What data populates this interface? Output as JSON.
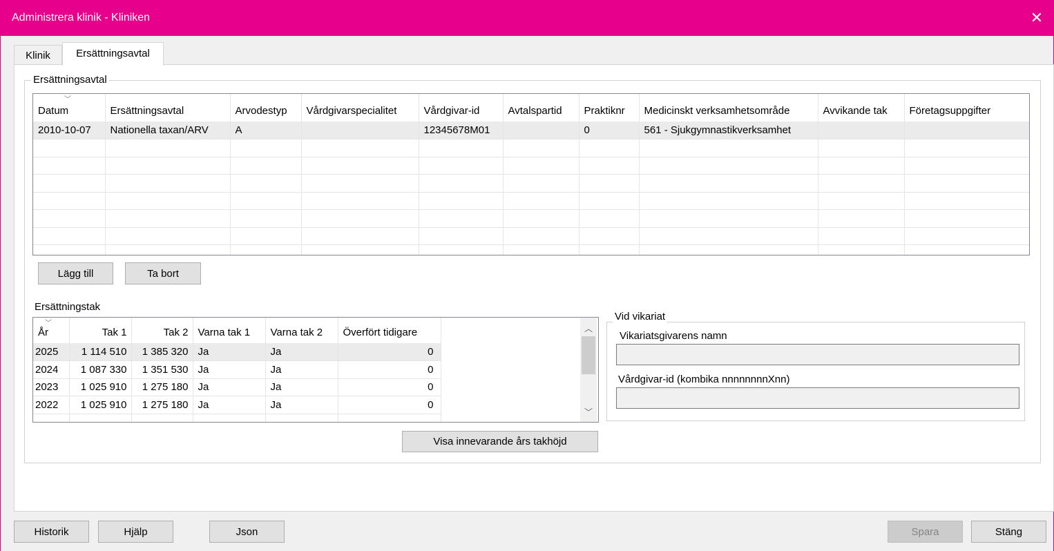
{
  "window": {
    "title": "Administrera klinik - Kliniken",
    "close_glyph": "✕",
    "accent_color": "#e6008b"
  },
  "tabs": [
    {
      "label": "Klinik",
      "active": false
    },
    {
      "label": "Ersättningsavtal",
      "active": true
    }
  ],
  "agreements": {
    "group_label": "Ersättningsavtal",
    "columns": [
      "Datum",
      "Ersättningsavtal",
      "Arvodestyp",
      "Vårdgivarspecialitet",
      "Vårdgivar-id",
      "Avtalspartid",
      "Praktiknr",
      "Medicinskt verksamhetsområde",
      "Avvikande tak",
      "Företagsuppgifter"
    ],
    "rows": [
      [
        "2010-10-07",
        "Nationella taxan/ARV",
        "A",
        "",
        "12345678M01",
        "",
        "0",
        "561 - Sjukgymnastikverksamhet",
        "",
        ""
      ]
    ],
    "add_button": "Lägg till",
    "remove_button": "Ta bort"
  },
  "caps": {
    "label": "Ersättningstak",
    "columns": [
      "År",
      "Tak 1",
      "Tak 2",
      "Varna tak 1",
      "Varna tak 2",
      "Överfört tidigare"
    ],
    "rows": [
      [
        "2025",
        "1 114 510",
        "1 385 320",
        "Ja",
        "Ja",
        "0"
      ],
      [
        "2024",
        "1 087 330",
        "1 351 530",
        "Ja",
        "Ja",
        "0"
      ],
      [
        "2023",
        "1 025 910",
        "1 275 180",
        "Ja",
        "Ja",
        "0"
      ],
      [
        "2022",
        "1 025 910",
        "1 275 180",
        "Ja",
        "Ja",
        "0"
      ]
    ],
    "show_current_button": "Visa innevarande års takhöjd"
  },
  "substitute": {
    "group_label": "Vid vikariat",
    "name_label": "Vikariatsgivarens namn",
    "name_value": "",
    "id_label": "Vårdgivar-id (kombika nnnnnnnnXnn)",
    "id_value": ""
  },
  "footer": {
    "history": "Historik",
    "help": "Hjälp",
    "json": "Json",
    "save": "Spara",
    "close": "Stäng"
  }
}
